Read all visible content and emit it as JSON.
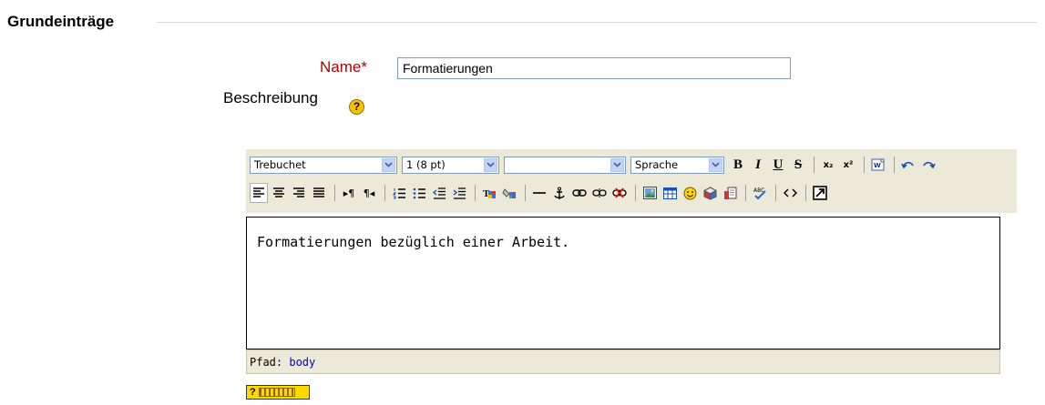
{
  "section": {
    "legend": "Grundeinträge"
  },
  "form": {
    "name_label": "Name*",
    "name_value": "Formatierungen",
    "description_label": "Beschreibung",
    "help_glyph": "?"
  },
  "toolbar": {
    "font_select": "Trebuchet",
    "size_select": "1 (8 pt)",
    "style_select": "",
    "language_select": "Sprache",
    "bold": "B",
    "italic": "I",
    "underline": "U",
    "strikethrough": "S",
    "subscript": "x₂",
    "superscript": "x²"
  },
  "editor": {
    "content": "Formatierungen bezüglich einer Arbeit."
  },
  "status": {
    "path_label": "Pfad:",
    "path_value": "body"
  },
  "colors": {
    "required": "#b00000",
    "toolbar_bg": "#ece9d8",
    "link": "#0000cc",
    "help_badge": "#f5c400"
  }
}
